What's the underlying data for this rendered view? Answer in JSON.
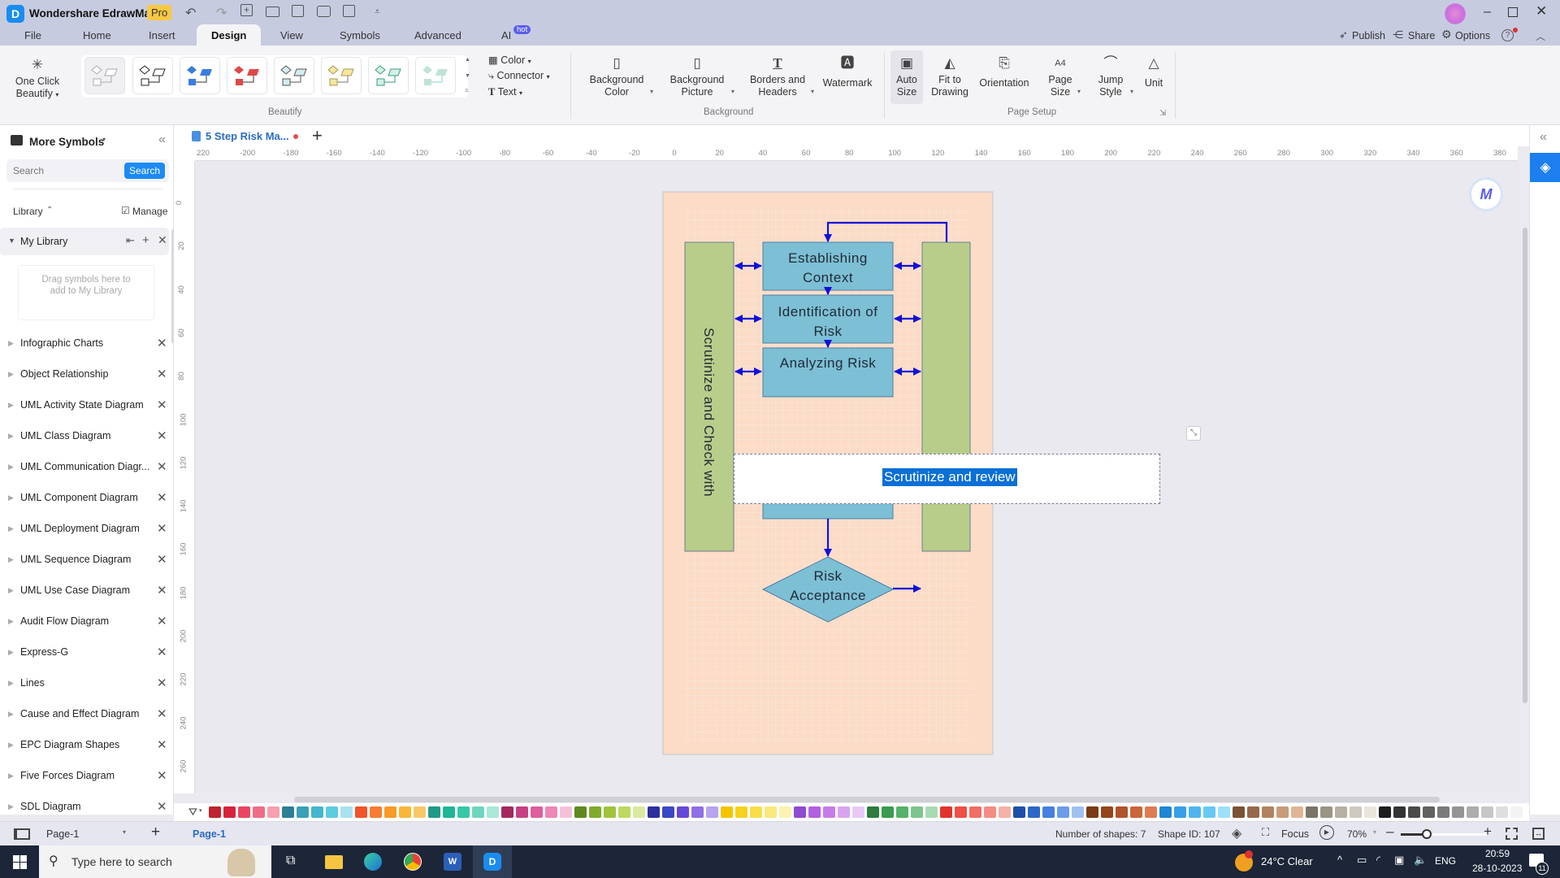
{
  "app": {
    "title": "Wondershare EdrawMax",
    "badge": "Pro"
  },
  "menu_tabs": [
    {
      "label": "File"
    },
    {
      "label": "Home"
    },
    {
      "label": "Insert"
    },
    {
      "label": "Design",
      "active": true
    },
    {
      "label": "View"
    },
    {
      "label": "Symbols"
    },
    {
      "label": "Advanced"
    },
    {
      "label": "AI",
      "badge": "hot"
    }
  ],
  "top_right": {
    "publish": "Publish",
    "share": "Share",
    "options": "Options"
  },
  "ribbon": {
    "one_click_beautify": "One Click Beautify",
    "beautify_group": "Beautify",
    "color": "Color",
    "connector": "Connector",
    "text": "Text",
    "background_color": "Background Color",
    "background_picture": "Background Picture",
    "borders_headers": "Borders and Headers",
    "watermark": "Watermark",
    "background_group": "Background",
    "auto_size": "Auto Size",
    "fit_to_drawing": "Fit to Drawing",
    "orientation": "Orientation",
    "page_size": "Page Size",
    "jump_style": "Jump Style",
    "unit": "Unit",
    "page_setup_group": "Page Setup"
  },
  "left_panel": {
    "title": "More Symbols",
    "search_placeholder": "Search",
    "search_button": "Search",
    "library_label": "Library",
    "manage_label": "Manage",
    "my_library": "My Library",
    "drop_hint": "Drag symbols here to add to My Library",
    "libraries": [
      "Infographic Charts",
      "Object Relationship",
      "UML Activity State Diagram",
      "UML Class Diagram",
      "UML Communication Diagr...",
      "UML Component Diagram",
      "UML Deployment Diagram",
      "UML Sequence Diagram",
      "UML Use Case Diagram",
      "Audit Flow Diagram",
      "Express-G",
      "Lines",
      "Cause and Effect Diagram",
      "EPC Diagram Shapes",
      "Five Forces Diagram",
      "SDL Diagram"
    ]
  },
  "document": {
    "tab_title": "5 Step Risk Ma...",
    "unsaved": true
  },
  "rulers": {
    "horizontal": [
      "220",
      "-200",
      "-180",
      "-160",
      "-140",
      "-120",
      "-100",
      "-80",
      "-60",
      "-40",
      "-20",
      "0",
      "20",
      "40",
      "60",
      "80",
      "100",
      "120",
      "140",
      "160",
      "180",
      "200",
      "220",
      "240",
      "260",
      "280",
      "300",
      "320",
      "340",
      "360",
      "380"
    ],
    "vertical": [
      "0",
      "20",
      "40",
      "60",
      "80",
      "100",
      "120",
      "140",
      "160",
      "180",
      "200",
      "220",
      "240",
      "260"
    ]
  },
  "diagram": {
    "left_bar_text": "Scrutinize and Check with",
    "steps": [
      "Establishing Context",
      "Identification of Risk",
      "Analyzing Risk"
    ],
    "decision": "Risk Acceptance",
    "editing_text": "Scrutinize and review",
    "colors": {
      "page_bg": "#fcdcc6",
      "box_fill": "#7dbfd4",
      "bar_fill": "#b8cd8a",
      "arrow": "#1010d8",
      "selection": "#0a6fd6"
    }
  },
  "palette": [
    "#c0232f",
    "#d9223c",
    "#e94560",
    "#f06c86",
    "#f7a0b0",
    "#2d7f96",
    "#3aa0b8",
    "#42b6d0",
    "#5ccbe0",
    "#a8e2f0",
    "#f0542a",
    "#f77b33",
    "#f89a26",
    "#f9b637",
    "#f8c866",
    "#1e9a86",
    "#20b597",
    "#35c8a7",
    "#6dd6bd",
    "#a7e8d6",
    "#a3285e",
    "#c74082",
    "#de5e9e",
    "#ef86b6",
    "#f4c2d8",
    "#5c8a1f",
    "#7fab2a",
    "#9fc43b",
    "#bcd85f",
    "#d9eaa0",
    "#2c2f9e",
    "#3b47c6",
    "#6648d8",
    "#8f6fe5",
    "#b7a3ef",
    "#f5c400",
    "#f7d21d",
    "#f8df4a",
    "#f9e97b",
    "#fbf3b0",
    "#8f4bd0",
    "#b35fe0",
    "#c97aea",
    "#d9a2f0",
    "#e8c9f6",
    "#2c7d3e",
    "#3a9a50",
    "#55b26a",
    "#7cc48c",
    "#a8dbb2",
    "#e2332b",
    "#ee5044",
    "#f26d63",
    "#f58c84",
    "#f8b0aa",
    "#1e4fa8",
    "#2d66c9",
    "#477fe0",
    "#6d9ce9",
    "#a1c0f2",
    "#7a3b16",
    "#95451b",
    "#b0532a",
    "#c9653a",
    "#e07c53",
    "#1f86d6",
    "#36a0e8",
    "#4db6f0",
    "#66c9f5",
    "#9ee0fa",
    "#7b5236",
    "#96684a",
    "#b0825f",
    "#c99b78",
    "#e0b594",
    "#7a7566",
    "#9a9484",
    "#b6b1a2",
    "#cdc9bc",
    "#e8e5da",
    "#1d1d1d",
    "#333333",
    "#4a4a4a",
    "#616161",
    "#7a7a7a",
    "#949494",
    "#adadad",
    "#c6c6c6",
    "#dedede",
    "#f3f3f3"
  ],
  "pages": {
    "selector": "Page-1",
    "active_tab": "Page-1"
  },
  "status": {
    "shapes": "Number of shapes: 7",
    "shape_id": "Shape ID: 107",
    "focus": "Focus",
    "zoom": "70%",
    "zoom_level": 0.3
  },
  "taskbar": {
    "search_placeholder": "Type here to search",
    "weather": "24°C  Clear",
    "lang": "ENG",
    "time": "20:59",
    "date": "28-10-2023",
    "notifications": "11"
  }
}
